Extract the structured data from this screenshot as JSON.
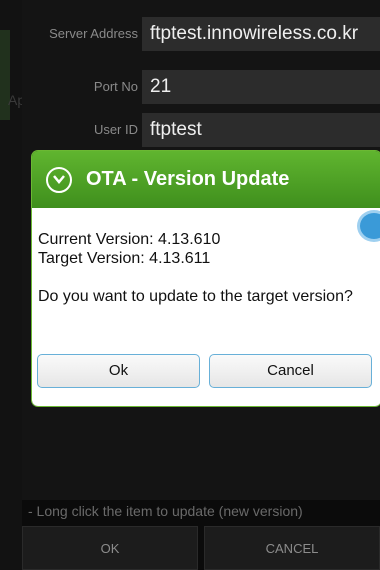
{
  "background": {
    "app_label": "App",
    "fields": [
      {
        "label": "Server Address",
        "value": "ftptest.innowireless.co.kr"
      },
      {
        "label": "Port No",
        "value": "21"
      },
      {
        "label": "User ID",
        "value": "ftptest"
      }
    ],
    "hint": "- Long click the item to update (new version)",
    "ok_label": "OK",
    "cancel_label": "CANCEL"
  },
  "dialog": {
    "title": "OTA - Version Update",
    "icon": "chevron-down-circle-icon",
    "current_version": "Current Version: 4.13.610",
    "target_version": "Target Version: 4.13.611",
    "question": "Do you want to update to the target version?",
    "ok_label": "Ok",
    "cancel_label": "Cancel"
  },
  "colors": {
    "header_green": "#4ea326",
    "button_border": "#68b0d8"
  }
}
